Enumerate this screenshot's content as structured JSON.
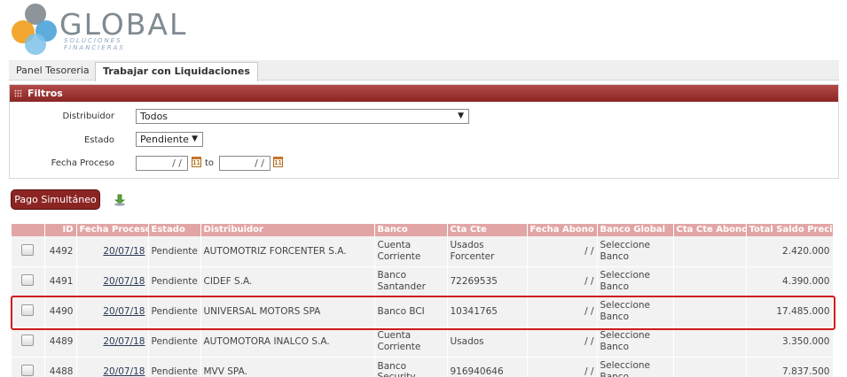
{
  "logo": {
    "text": "GLOBAL",
    "subtitle": "SOLUCIONES FINANCIERAS"
  },
  "tabs": [
    {
      "label": "Panel Tesoreria"
    },
    {
      "label": "Trabajar con Liquidaciones"
    }
  ],
  "filters": {
    "title": "Filtros",
    "distribuidor_label": "Distribuidor",
    "distribuidor_value": "Todos",
    "estado_label": "Estado",
    "estado_value": "Pendiente",
    "fecha_label": "Fecha Proceso",
    "fecha_from": "/ /",
    "fecha_to_label": "to",
    "fecha_to": "/ /"
  },
  "actions": {
    "pago_label": "Pago Simultáneo"
  },
  "table": {
    "columns": [
      "ID",
      "Fecha Proceso",
      "Estado",
      "Distribuidor",
      "Banco",
      "Cta Cte",
      "Fecha Abono",
      "Banco Global",
      "Cta Cte Abono",
      "Total Saldo Precio"
    ],
    "rows": [
      {
        "id": "4492",
        "fecha": "20/07/18",
        "estado": "Pendiente",
        "distribuidor": "AUTOMOTRIZ FORCENTER S.A.",
        "banco": "Cuenta Corriente",
        "cta": "Usados Forcenter",
        "abono": "/ /",
        "banco_global": "Seleccione Banco",
        "cta_abono": "",
        "total": "2.420.000"
      },
      {
        "id": "4491",
        "fecha": "20/07/18",
        "estado": "Pendiente",
        "distribuidor": "CIDEF S.A.",
        "banco": "Banco Santander",
        "cta": "72269535",
        "abono": "/ /",
        "banco_global": "Seleccione Banco",
        "cta_abono": "",
        "total": "4.390.000"
      },
      {
        "id": "4490",
        "fecha": "20/07/18",
        "estado": "Pendiente",
        "distribuidor": "UNIVERSAL MOTORS SPA",
        "banco": "Banco BCI",
        "cta": "10341765",
        "abono": "/ /",
        "banco_global": "Seleccione Banco",
        "cta_abono": "",
        "total": "17.485.000"
      },
      {
        "id": "4489",
        "fecha": "20/07/18",
        "estado": "Pendiente",
        "distribuidor": "AUTOMOTORA INALCO S.A.",
        "banco": "Cuenta Corriente",
        "cta": "Usados",
        "abono": "/ /",
        "banco_global": "Seleccione Banco",
        "cta_abono": "",
        "total": "3.350.000"
      },
      {
        "id": "4488",
        "fecha": "20/07/18",
        "estado": "Pendiente",
        "distribuidor": "MVV SPA.",
        "banco": "Banco Security",
        "cta": "916940646",
        "abono": "/ /",
        "banco_global": "Seleccione Banco",
        "cta_abono": "",
        "total": "7.837.500"
      }
    ]
  },
  "colors": {
    "brand_red": "#8a2523",
    "header_pink": "#e2a5a5",
    "highlight": "#d11b1b"
  }
}
